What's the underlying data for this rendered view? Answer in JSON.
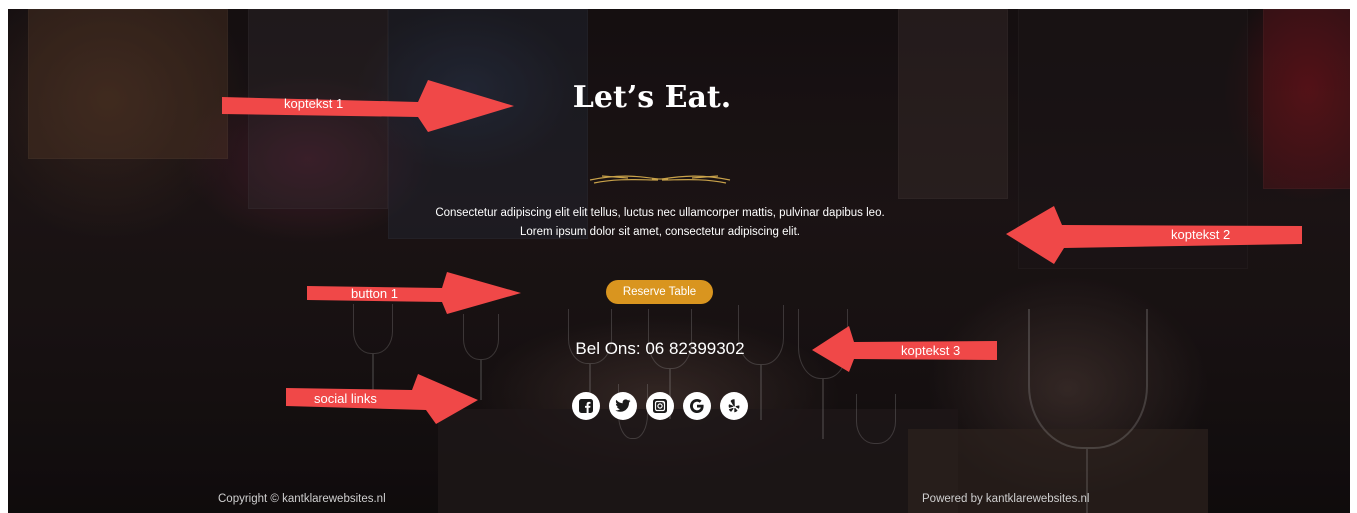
{
  "hero": {
    "title": "Let’s Eat.",
    "description": "Consectetur adipiscing elit elit tellus, luctus nec ullamcorper mattis, pulvinar dapibus leo. Lorem ipsum dolor sit amet, consectetur adipiscing elit.",
    "button_label": "Reserve Table",
    "phone_text": "Bel Ons: 06 82399302"
  },
  "social": [
    {
      "icon": "facebook-icon",
      "glyph": "f"
    },
    {
      "icon": "twitter-icon",
      "glyph": "t"
    },
    {
      "icon": "instagram-icon",
      "glyph": "i"
    },
    {
      "icon": "google-icon",
      "glyph": "G"
    },
    {
      "icon": "yelp-icon",
      "glyph": "y"
    }
  ],
  "footer": {
    "copyright": "Copyright © kantklarewebsites.nl",
    "powered": "Powered by kantklarewebsites.nl"
  },
  "annotations": {
    "koptekst1": "koptekst 1",
    "koptekst2": "koptekst 2",
    "koptekst3": "koptekst 3",
    "button1": "button 1",
    "social_links": "social links"
  },
  "colors": {
    "accent": "#d9951f",
    "annotation_arrow": "#f04848",
    "text": "#ffffff"
  }
}
